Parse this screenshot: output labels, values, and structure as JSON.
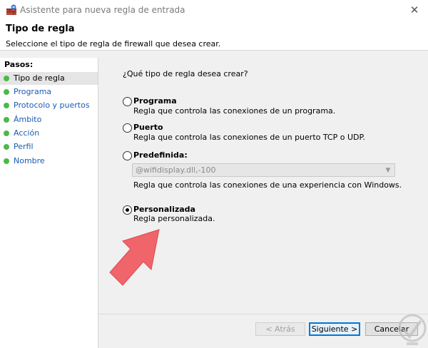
{
  "window": {
    "title": "Asistente para nueva regla de entrada",
    "close_glyph": "✕"
  },
  "header": {
    "title": "Tipo de regla",
    "subtitle": "Seleccione el tipo de regla de firewall que desea crear."
  },
  "nav": {
    "heading": "Pasos:",
    "items": [
      {
        "label": "Tipo de regla",
        "active": true
      },
      {
        "label": "Programa"
      },
      {
        "label": "Protocolo y puertos"
      },
      {
        "label": "Ámbito"
      },
      {
        "label": "Acción"
      },
      {
        "label": "Perfil"
      },
      {
        "label": "Nombre"
      }
    ],
    "dot_color": "#4cb848",
    "link_color": "#1a5bb5"
  },
  "main": {
    "question": "¿Qué tipo de regla desea crear?",
    "options": [
      {
        "title": "Programa",
        "desc": "Regla que controla las conexiones de un programa.",
        "checked": false
      },
      {
        "title": "Puerto",
        "desc": "Regla que controla las conexiones de un puerto TCP o UDP.",
        "checked": false
      },
      {
        "title": "Predefinida:",
        "desc": "Regla que controla las conexiones de una experiencia con Windows.",
        "checked": false
      },
      {
        "title": "Personalizada",
        "desc": "Regla personalizada.",
        "checked": true
      }
    ],
    "predefined_combo": {
      "value": "@wifidisplay.dll,-100",
      "disabled": true
    }
  },
  "buttons": {
    "back": "< Atrás",
    "next": "Siguiente >",
    "cancel": "Cancelar"
  },
  "annotation": {
    "arrow_color": "#f0656a"
  }
}
